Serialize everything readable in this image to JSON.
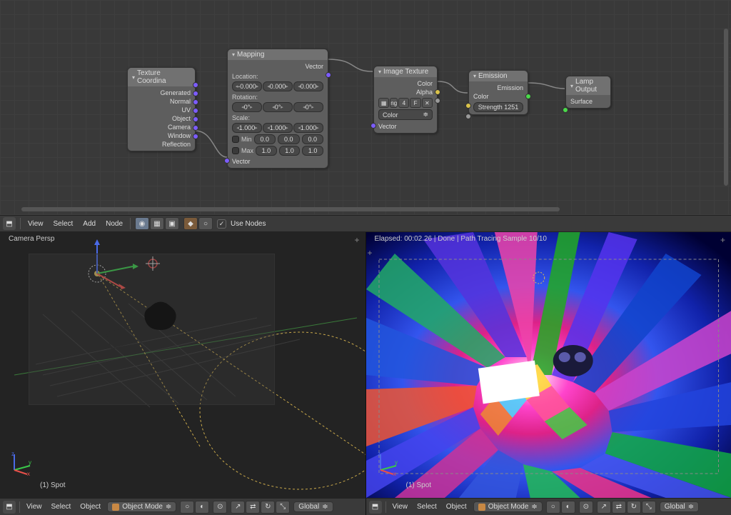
{
  "node_editor": {
    "nodes": {
      "tex_coord": {
        "title": "Texture Coordina",
        "outputs": [
          "Generated",
          "Normal",
          "UV",
          "Object",
          "Camera",
          "Window",
          "Reflection"
        ]
      },
      "mapping": {
        "title": "Mapping",
        "out": "Vector",
        "in": "Vector",
        "location_label": "Location:",
        "location": [
          "-0.000",
          "0.000",
          "0.000"
        ],
        "rotation_label": "Rotation:",
        "rotation": [
          "0°",
          "0°",
          "0°"
        ],
        "scale_label": "Scale:",
        "scale": [
          "1.000",
          "1.000",
          "1.000"
        ],
        "min_label": "Min",
        "min": [
          "0.0",
          "0.0",
          "0.0"
        ],
        "max_label": "Max",
        "max": [
          "1.0",
          "1.0",
          "1.0"
        ]
      },
      "image_tex": {
        "title": "Image Texture",
        "outputs": [
          "Color",
          "Alpha"
        ],
        "in": "Vector",
        "file_snip": "ng",
        "users": "4",
        "f": "F",
        "colorspace": "Color"
      },
      "emission": {
        "title": "Emission",
        "out": "Emission",
        "color_label": "Color",
        "strength": "Strength 1251"
      },
      "output": {
        "title": "Lamp Output",
        "surface": "Surface"
      }
    }
  },
  "node_toolbar": {
    "menu": [
      "View",
      "Select",
      "Add",
      "Node"
    ],
    "use_nodes": "Use Nodes"
  },
  "viewports": {
    "left": {
      "label": "Camera Persp",
      "spot": "(1) Spot"
    },
    "right": {
      "status": "Elapsed: 00:02.26 | Done | Path Tracing Sample 10/10",
      "spot": "(1) Spot"
    }
  },
  "vp_toolbar": {
    "menu": [
      "View",
      "Select",
      "Object"
    ],
    "mode": "Object Mode",
    "global": "Global"
  }
}
